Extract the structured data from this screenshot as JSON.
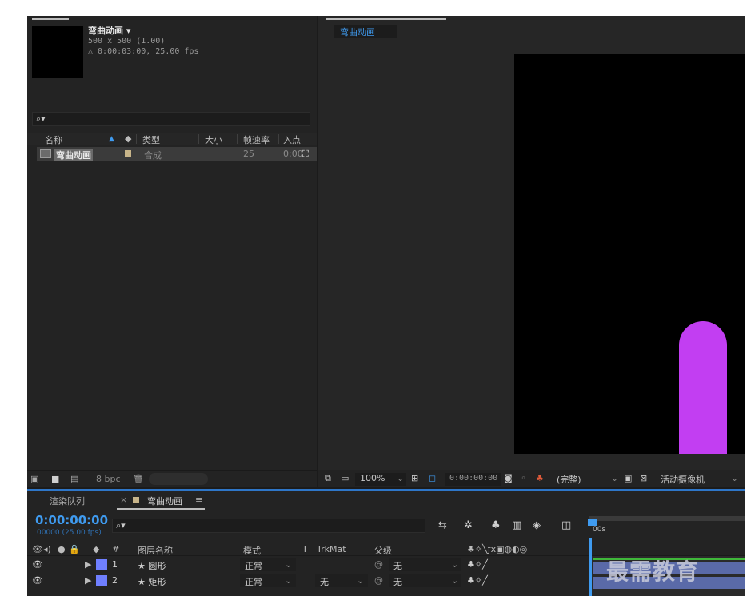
{
  "project": {
    "comp_name": "弯曲动画 ▾",
    "comp_size": "500 x 500 (1.00)",
    "comp_duration": "△ 0:00:03:00, 25.00 fps",
    "search_icon": "⌕▾",
    "columns": {
      "name": "名称",
      "type": "类型",
      "size": "大小",
      "fps": "帧速率",
      "in": "入点"
    },
    "items": [
      {
        "name": "弯曲动画",
        "type": "合成",
        "fps": "25",
        "in": "0:00"
      }
    ],
    "bit_depth": "8 bpc"
  },
  "viewer": {
    "tab": "弯曲动画",
    "zoom": "100%",
    "timecode": "0:00:00:00",
    "resolution": "(完整)",
    "camera": "活动摄像机",
    "shape_color": "#c23ef2"
  },
  "timeline": {
    "tab_render": "渲染队列",
    "tab_comp": "弯曲动画",
    "close_mark": "×",
    "menu_mark": "≡",
    "timecode": "0:00:00:00",
    "fps_note": "00000 (25.00 fps)",
    "search_icon": "⌕▾",
    "ruler_label": "00s",
    "headers": {
      "num": "#",
      "layer_name": "图层名称",
      "mode": "模式",
      "t": "T",
      "trkmat": "TrkMat",
      "parent": "父级"
    },
    "layers": [
      {
        "num": "1",
        "name": "★ 圆形",
        "mode": "正常",
        "trkmat": "",
        "parent": "无",
        "color": "#6f7fff"
      },
      {
        "num": "2",
        "name": "★ 矩形",
        "mode": "正常",
        "trkmat": "无",
        "parent": "无",
        "color": "#6f7fff"
      }
    ]
  },
  "watermark": "最需教育"
}
